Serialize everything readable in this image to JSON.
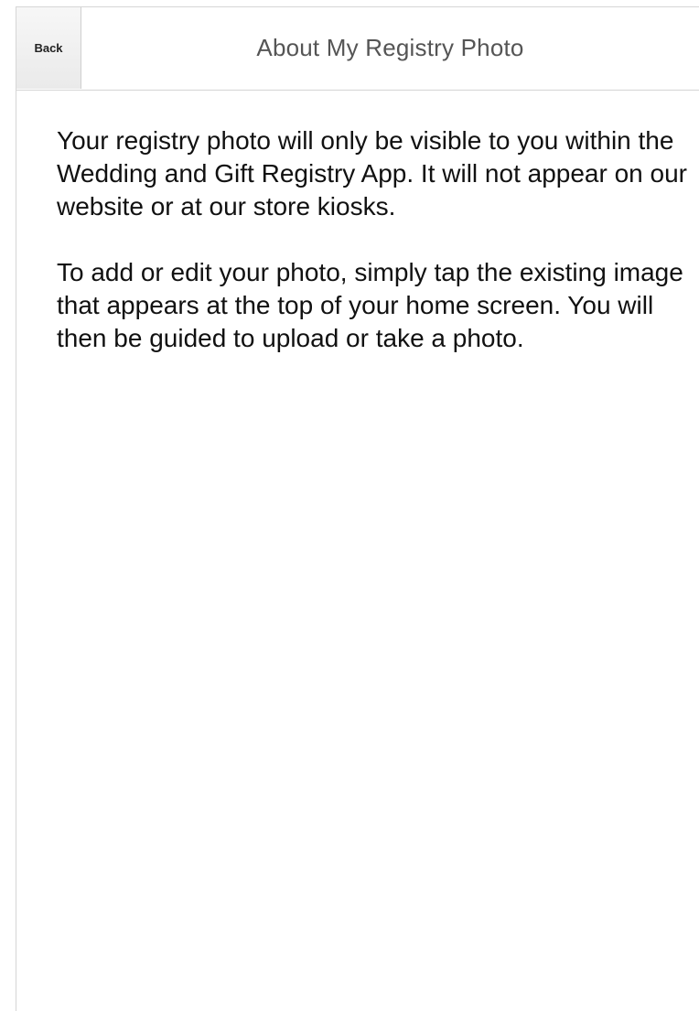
{
  "header": {
    "back_label": "Back",
    "title": "About My Registry Photo"
  },
  "content": {
    "paragraphs": [
      "Your registry photo will only be visible to you within the Wedding and Gift Registry App. It will not appear on our website or at our store kiosks.",
      "To add or edit your photo, simply tap the existing image that appears at the top of your home screen. You will then be guided to upload or take a photo."
    ]
  }
}
